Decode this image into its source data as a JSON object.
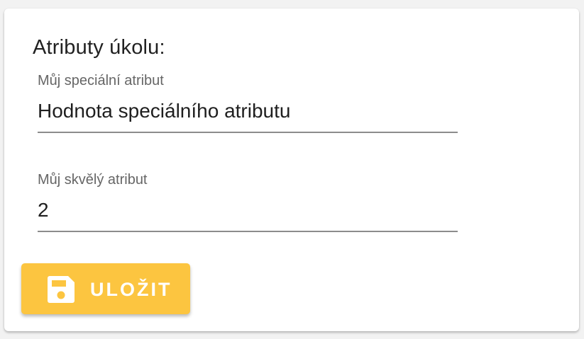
{
  "form": {
    "title": "Atributy úkolu:",
    "fields": [
      {
        "label": "Můj speciální atribut",
        "value": "Hodnota speciálního atributu"
      },
      {
        "label": "Můj skvělý atribut",
        "value": "2"
      }
    ],
    "save_button": {
      "label": "ULOŽIT",
      "icon": "save-icon",
      "color": "#fcc540"
    }
  }
}
